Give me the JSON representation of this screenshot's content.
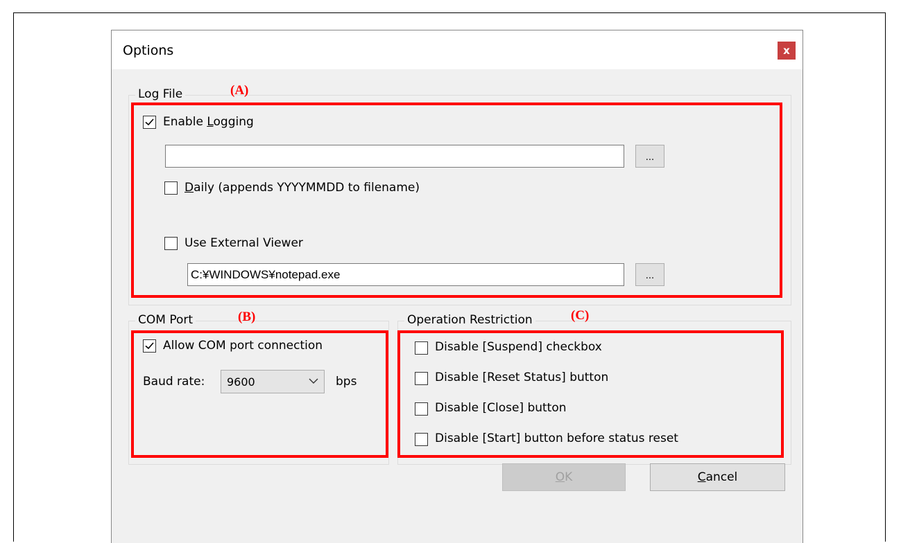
{
  "dialog": {
    "title": "Options",
    "close_label": "x"
  },
  "log_file": {
    "legend": "Log File",
    "marker": "(A)",
    "enable_logging": {
      "prefix": "Enable ",
      "accel": "L",
      "suffix": "ogging",
      "checked": true
    },
    "log_path": {
      "value": "",
      "placeholder": ""
    },
    "log_browse_label": "...",
    "daily": {
      "accel": "D",
      "suffix": "aily (appends YYYYMMDD to filename)",
      "checked": false
    },
    "external_viewer": {
      "label": "Use External Viewer",
      "checked": false
    },
    "viewer_path": {
      "value": "C:¥WINDOWS¥notepad.exe"
    },
    "viewer_browse_label": "..."
  },
  "com_port": {
    "legend": "COM Port",
    "marker": "(B)",
    "allow_connection": {
      "label": "Allow COM port connection",
      "checked": true
    },
    "baud_label": "Baud rate:",
    "baud_value": "9600",
    "baud_unit": "bps"
  },
  "operation_restriction": {
    "legend": "Operation Restriction",
    "marker": "(C)",
    "items": [
      {
        "label": "Disable [Suspend] checkbox",
        "checked": false
      },
      {
        "label": "Disable [Reset Status] button",
        "checked": false
      },
      {
        "label": "Disable [Close] button",
        "checked": false
      },
      {
        "label": "Disable [Start] button before status reset",
        "checked": false
      }
    ]
  },
  "buttons": {
    "ok": {
      "accel": "O",
      "suffix": "K"
    },
    "cancel": {
      "accel": "C",
      "suffix": "ancel"
    }
  },
  "colors": {
    "annotation_red": "#ff0000",
    "dialog_bg": "#f0f0f0",
    "close_bg": "#c84040"
  }
}
